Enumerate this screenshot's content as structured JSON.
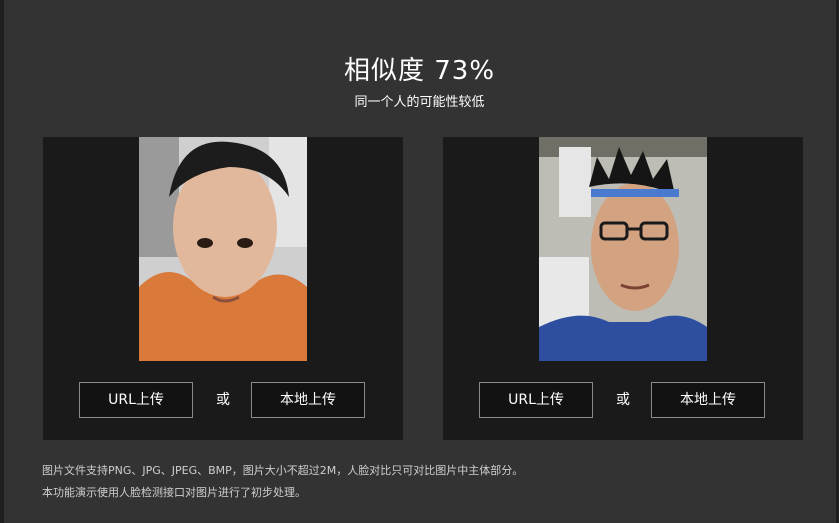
{
  "result": {
    "title": "相似度 73%",
    "subtitle": "同一个人的可能性较低"
  },
  "panels": [
    {
      "url_button": "URL上传",
      "or_label": "或",
      "local_button": "本地上传"
    },
    {
      "url_button": "URL上传",
      "or_label": "或",
      "local_button": "本地上传"
    }
  ],
  "notes": [
    "图片文件支持PNG、JPG、JPEG、BMP，图片大小不超过2M，人脸对比只可对比图片中主体部分。",
    "本功能演示使用人脸检测接口对图片进行了初步处理。"
  ],
  "colors": {
    "background": "#333333",
    "panel": "#1a1a1a",
    "button_border": "#8a8a8a",
    "text": "#ffffff"
  }
}
